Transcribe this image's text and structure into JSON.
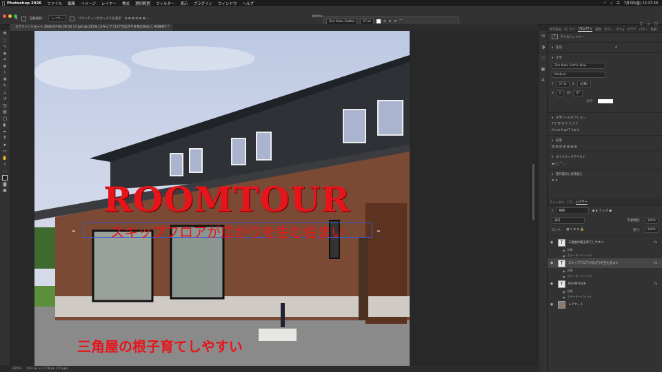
{
  "menubar": {
    "app_name": "Photoshop 2026",
    "menus": [
      "ファイル",
      "編集",
      "イメージ",
      "レイヤー",
      "書式",
      "選択範囲",
      "フィルター",
      "表示",
      "プラグイン",
      "ウィンドウ",
      "ヘルプ"
    ],
    "clock": "7月3日(金)  22:27:30"
  },
  "options_bar": {
    "auto_select_label": "自動選択：",
    "auto_select_value": "レイヤー",
    "transform_label": "バウンディングボックスを表示",
    "adobe_label": "Adobe"
  },
  "text_context_bar": {
    "font": "Zen Kaku Gothic",
    "size": "27 pt"
  },
  "document_tab": {
    "title": "スクリーンショット 2026-07-03 20.54.17.psd @ 225% (スキップフロアが広がりを生む住まい, RGB/8*) *"
  },
  "canvas_text": {
    "headline": "ROOMTOUR",
    "subline": "スキップフロアが広がりを生む住まい",
    "subline_prefix": "-",
    "subline_suffix": "-",
    "caption": "三角屋の根子育てしやすい"
  },
  "status_bar": {
    "zoom": "225%",
    "doc_size": "543 px × 1178 px (72 ppi)"
  },
  "properties_panel": {
    "tabs": [
      "文字組み",
      "CC ライ",
      "プロパティ",
      "属性",
      "カラー",
      "スウォ",
      "グラデ",
      "パター",
      "色調"
    ],
    "layer_type": "テキストレイヤー",
    "transform_label": "変形",
    "char_label": "文字",
    "font_family": "Zen Kaku Gothic New",
    "font_style": "Medium",
    "font_size": "27 pt",
    "leading": "(自動)",
    "tracking": "0",
    "kerning": "97",
    "color_label": "カラー",
    "text_options_label": "文字ツールオプション",
    "paragraph_label": "段落",
    "dynamic_text_label": "ダイナミックテキスト",
    "vertical_label": "整列書式と段落揃え"
  },
  "layers_panel": {
    "tabs": [
      "チャンネル",
      "パス",
      "レイヤー"
    ],
    "filter": "種類",
    "blend_mode": "通常",
    "opacity_label": "不透明度：",
    "opacity": "100%",
    "lock_label": "ロック：",
    "fill_label": "塗り：",
    "fill": "100%",
    "layers": [
      {
        "name": "三角屋の根子育てしやすい",
        "kind": "text",
        "effects": [
          "効果",
          "カラーオーバーレイ"
        ],
        "active": false
      },
      {
        "name": "スキップフロアが広がりを生む住まい",
        "kind": "text",
        "effects": [
          "効果",
          "カラーオーバーレイ"
        ],
        "active": true
      },
      {
        "name": "ROOMTOUR",
        "kind": "text",
        "effects": [
          "効果",
          "カラーオーバーレイ"
        ],
        "active": false
      },
      {
        "name": "レイヤー 1",
        "kind": "image",
        "effects": [],
        "active": false
      }
    ]
  },
  "colors": {
    "accent_red": "#e8141b",
    "panel_bg": "#323232",
    "canvas_bg": "#282828"
  }
}
